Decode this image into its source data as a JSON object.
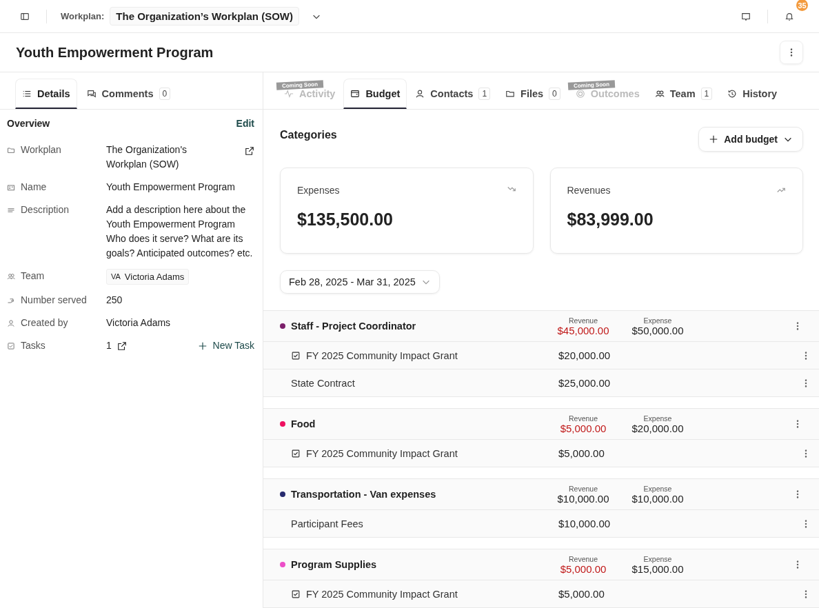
{
  "topbar": {
    "workplan_label": "Workplan:",
    "workplan_value": "The Organization’s Workplan (SOW)",
    "notification_count": "35"
  },
  "title": "Youth Empowerment Program",
  "left_tabs": [
    {
      "label": "Details",
      "selected": true
    },
    {
      "label": "Comments",
      "count": "0",
      "selected": false
    }
  ],
  "overview": {
    "title": "Overview",
    "edit": "Edit",
    "fields": [
      {
        "kind": "link",
        "label": "Workplan",
        "value": "The Organization's Workplan (SOW)"
      },
      {
        "kind": "text",
        "label": "Name",
        "value": "Youth Empowerment Program"
      },
      {
        "kind": "text",
        "label": "Description",
        "value": "Add a description here about the Youth Empowerment Program Who does it serve? What are its goals? Anticipated outcomes? etc."
      },
      {
        "kind": "person",
        "label": "Team",
        "initials": "VA",
        "value": "Victoria Adams"
      },
      {
        "kind": "text",
        "label": "Number served",
        "value": "250"
      },
      {
        "kind": "text",
        "label": "Created by",
        "value": "Victoria Adams"
      },
      {
        "kind": "tasks",
        "label": "Tasks",
        "value": "1",
        "action": "New Task"
      }
    ]
  },
  "right_tabs": [
    {
      "label": "Activity",
      "disabled": true,
      "ribbon": "Coming Soon",
      "selected": false
    },
    {
      "label": "Budget",
      "disabled": false,
      "selected": true
    },
    {
      "label": "Contacts",
      "count": "1",
      "disabled": false,
      "selected": false
    },
    {
      "label": "Files",
      "count": "0",
      "disabled": false,
      "selected": false
    },
    {
      "label": "Outcomes",
      "disabled": true,
      "ribbon": "Coming Soon",
      "selected": false
    },
    {
      "label": "Team",
      "count": "1",
      "disabled": false,
      "selected": false
    },
    {
      "label": "History",
      "disabled": false,
      "selected": false
    }
  ],
  "budget": {
    "title": "Categories",
    "add_button": "Add budget",
    "summary": [
      {
        "kind": "down",
        "label": "Expenses",
        "value": "$135,500.00"
      },
      {
        "kind": "up",
        "label": "Revenues",
        "value": "$83,999.00"
      }
    ],
    "date_range": "Feb 28, 2025 - Mar 31, 2025",
    "categories": [
      {
        "revenue_label": "Revenue",
        "expense_label": "Expense",
        "name": "Staff - Project Coordinator",
        "color": "#7b1f6a",
        "revenue": "$45,000.00",
        "expense": "$50,000.00",
        "shortfall": true,
        "items": [
          {
            "kind": "linked",
            "name": "FY 2025 Community Impact Grant",
            "amount": "$20,000.00"
          },
          {
            "kind": "plain",
            "name": "State Contract",
            "amount": "$25,000.00"
          }
        ]
      },
      {
        "revenue_label": "Revenue",
        "expense_label": "Expense",
        "name": "Food",
        "color": "#ee1060",
        "revenue": "$5,000.00",
        "expense": "$20,000.00",
        "shortfall": true,
        "items": [
          {
            "kind": "linked",
            "name": "FY 2025 Community Impact Grant",
            "amount": "$5,000.00"
          }
        ]
      },
      {
        "revenue_label": "Revenue",
        "expense_label": "Expense",
        "name": "Transportation - Van expenses",
        "color": "#262a6e",
        "revenue": "$10,000.00",
        "expense": "$10,000.00",
        "shortfall": false,
        "items": [
          {
            "kind": "plain",
            "name": "Participant Fees",
            "amount": "$10,000.00"
          }
        ]
      },
      {
        "revenue_label": "Revenue",
        "expense_label": "Expense",
        "name": "Program Supplies",
        "color": "#ec4fc8",
        "revenue": "$5,000.00",
        "expense": "$15,000.00",
        "shortfall": true,
        "items": [
          {
            "kind": "linked",
            "name": "FY 2025 Community Impact Grant",
            "amount": "$5,000.00"
          }
        ]
      }
    ]
  }
}
